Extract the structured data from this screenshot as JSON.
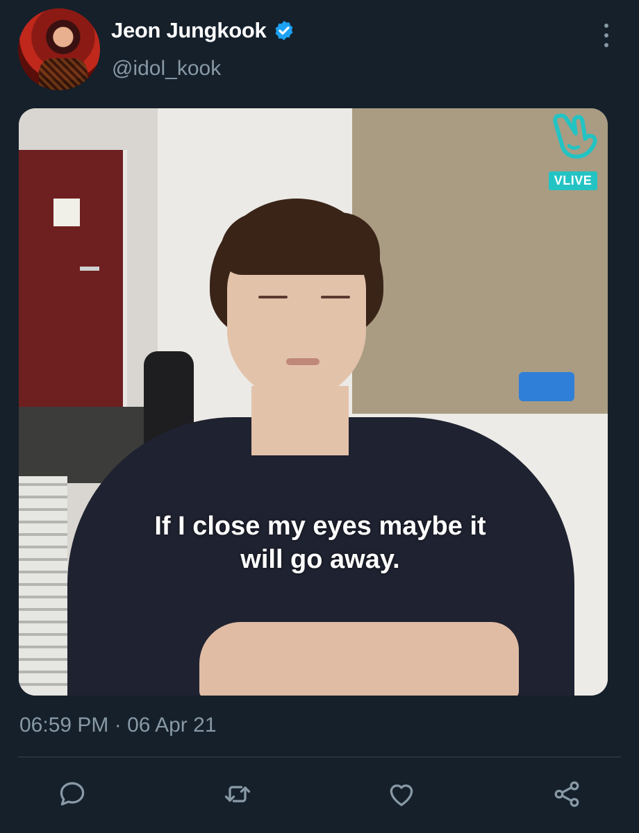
{
  "tweet": {
    "author_name": "Jeon Jungkook",
    "handle": "@idol_kook",
    "verified": true,
    "timestamp": "06:59 PM · 06 Apr 21",
    "media": {
      "caption_line1": "If I close my eyes maybe it",
      "caption_line2": "will go away.",
      "watermark": "VLIVE"
    }
  },
  "icons": {
    "more": "more-vertical-icon",
    "reply": "reply-icon",
    "retweet": "retweet-icon",
    "like": "heart-icon",
    "share": "share-icon"
  },
  "colors": {
    "background": "#15202b",
    "secondary_text": "#8899a6",
    "verified_blue": "#1da1f2",
    "divider": "#38444d"
  }
}
